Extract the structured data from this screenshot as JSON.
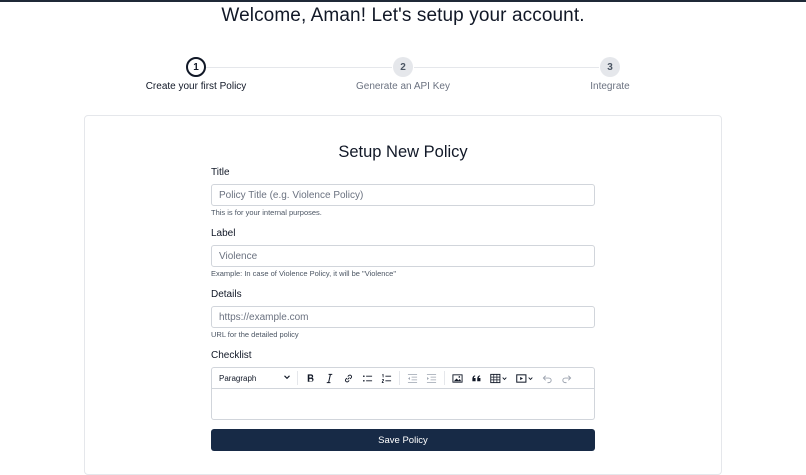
{
  "header": {
    "welcome": "Welcome, Aman! Let's setup your account."
  },
  "stepper": {
    "steps": [
      {
        "number": "1",
        "label": "Create your first Policy"
      },
      {
        "number": "2",
        "label": "Generate an API Key"
      },
      {
        "number": "3",
        "label": "Integrate"
      }
    ]
  },
  "form": {
    "title": "Setup New Policy",
    "fields": {
      "title": {
        "label": "Title",
        "placeholder": "Policy Title (e.g. Violence Policy)",
        "help": "This is for your internal purposes."
      },
      "label": {
        "label": "Label",
        "value": "Violence",
        "help": "Example: In case of Violence Policy, it will be \"Violence\""
      },
      "details": {
        "label": "Details",
        "placeholder": "https://example.com",
        "help": "URL for the detailed policy"
      },
      "checklist": {
        "label": "Checklist"
      }
    },
    "editor": {
      "block_format": "Paragraph",
      "tools": [
        "bold-icon",
        "italic-icon",
        "link-icon",
        "bulleted-list-icon",
        "numbered-list-icon",
        "outdent-icon",
        "indent-icon",
        "image-icon",
        "quote-icon",
        "table-icon",
        "media-icon",
        "undo-icon",
        "redo-icon"
      ]
    },
    "save_label": "Save Policy"
  },
  "colors": {
    "primary": "#172a46",
    "border": "#d1d5db",
    "text": "#111827",
    "muted": "#6b7280"
  }
}
